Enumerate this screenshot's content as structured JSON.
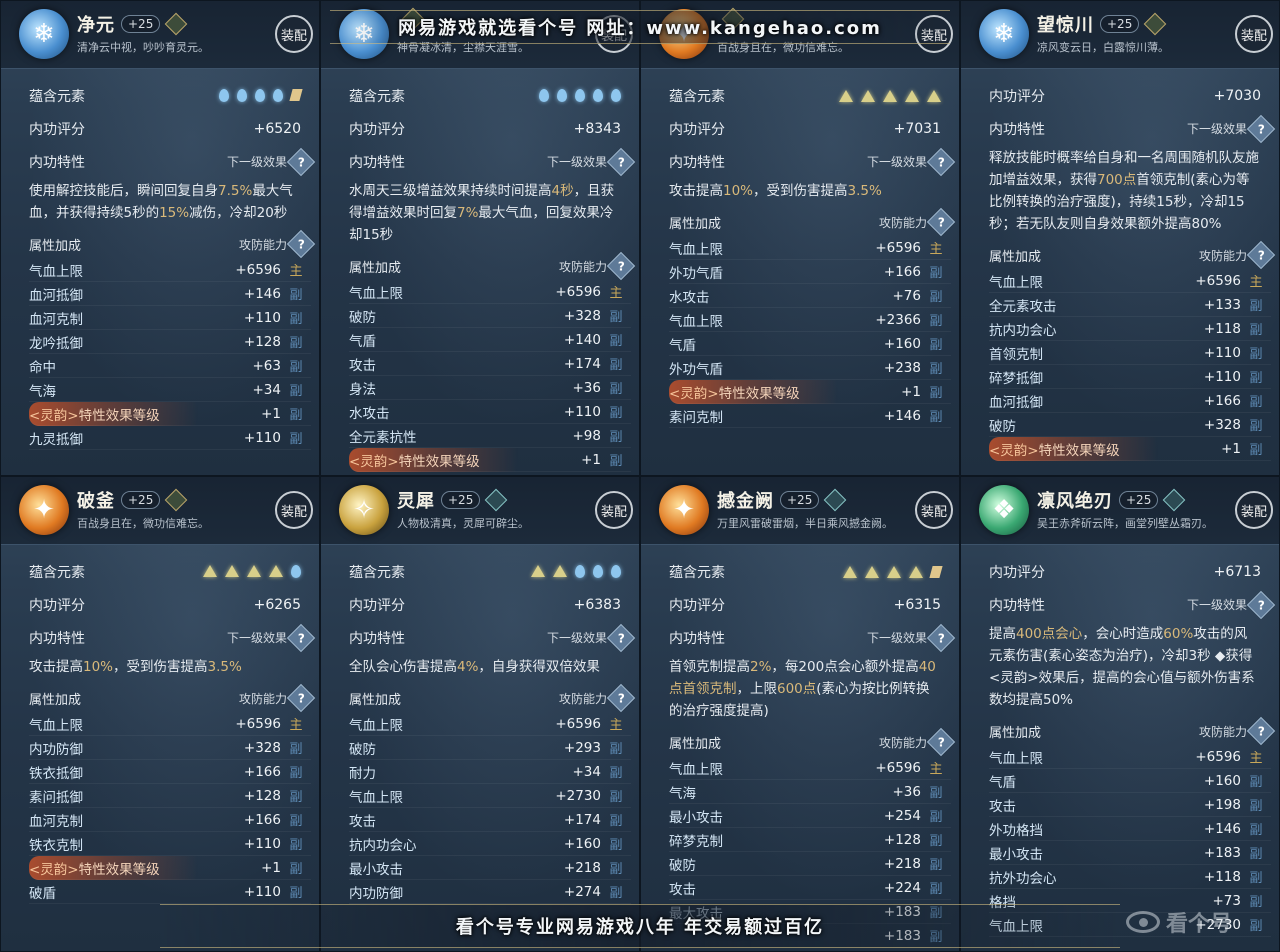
{
  "watermark_top": "网易游戏就选看个号   网址：www.kangehao.com",
  "watermark_bottom": "看个号专业网易游戏八年  年交易额过百亿",
  "corner_logo_text": "看个号",
  "common": {
    "equip": "装配",
    "elements_label": "蕴含元素",
    "score_label": "内功评分",
    "trait_label": "内功特性",
    "next_level": "下一级效果",
    "attr_label": "属性加成",
    "attr_sub": "攻防能力",
    "help": "?"
  },
  "cards": [
    {
      "name": "净元",
      "level": "+25",
      "emblem": "blue",
      "grade": "gold",
      "desc": "清净云中视，吵吵育灵元。",
      "elements": [
        "drop",
        "drop",
        "drop",
        "drop",
        "flag"
      ],
      "score": "+6520",
      "effect": [
        {
          "t": "使用解控技能后，瞬间回复自身"
        },
        {
          "t": "7.5%",
          "h": true
        },
        {
          "t": "最大气血，并获得持续5秒的"
        },
        {
          "t": "15%",
          "h": true
        },
        {
          "t": "减伤，冷却20秒"
        }
      ],
      "stats": [
        {
          "n": "气血上限",
          "v": "+6596",
          "t": "主"
        },
        {
          "n": "血河抵御",
          "v": "+146",
          "t": "副"
        },
        {
          "n": "血河克制",
          "v": "+110",
          "t": "副"
        },
        {
          "n": "龙吟抵御",
          "v": "+128",
          "t": "副"
        },
        {
          "n": "命中",
          "v": "+63",
          "t": "副"
        },
        {
          "n": "气海",
          "v": "+34",
          "t": "副"
        },
        {
          "n": "特性效果等级",
          "tag": "<灵韵>",
          "v": "+1",
          "t": "副",
          "special": true
        },
        {
          "n": "九灵抵御",
          "v": "+110",
          "t": "副"
        }
      ]
    },
    {
      "name": "",
      "level": "",
      "emblem": "blue",
      "grade": "gold",
      "desc": "神骨凝冰清，尘襟天涯雪。",
      "elements": [
        "drop",
        "drop",
        "drop",
        "drop",
        "drop"
      ],
      "score": "+8343",
      "effect": [
        {
          "t": "水周天三级增益效果持续时间提高"
        },
        {
          "t": "4秒",
          "h": true
        },
        {
          "t": "，且获得增益效果时回复"
        },
        {
          "t": "7%",
          "h": true
        },
        {
          "t": "最大气血，回复效果冷却15秒"
        }
      ],
      "stats": [
        {
          "n": "气血上限",
          "v": "+6596",
          "t": "主"
        },
        {
          "n": "破防",
          "v": "+328",
          "t": "副"
        },
        {
          "n": "气盾",
          "v": "+140",
          "t": "副"
        },
        {
          "n": "攻击",
          "v": "+174",
          "t": "副"
        },
        {
          "n": "身法",
          "v": "+36",
          "t": "副"
        },
        {
          "n": "水攻击",
          "v": "+110",
          "t": "副"
        },
        {
          "n": "全元素抗性",
          "v": "+98",
          "t": "副"
        },
        {
          "n": "特性效果等级",
          "tag": "<灵韵>",
          "v": "+1",
          "t": "副",
          "special": true
        }
      ]
    },
    {
      "name": "",
      "level": "",
      "emblem": "fire",
      "grade": "gold",
      "desc": "百战身且在，微功信难忘。",
      "elements": [
        "tri",
        "tri",
        "tri",
        "tri",
        "tri"
      ],
      "score": "+7031",
      "effect": [
        {
          "t": "攻击提高"
        },
        {
          "t": "10%",
          "h": true
        },
        {
          "t": "，受到伤害提高"
        },
        {
          "t": "3.5%",
          "h": true
        }
      ],
      "stats": [
        {
          "n": "气血上限",
          "v": "+6596",
          "t": "主"
        },
        {
          "n": "外功气盾",
          "v": "+166",
          "t": "副"
        },
        {
          "n": "水攻击",
          "v": "+76",
          "t": "副"
        },
        {
          "n": "气血上限",
          "v": "+2366",
          "t": "副"
        },
        {
          "n": "气盾",
          "v": "+160",
          "t": "副"
        },
        {
          "n": "外功气盾",
          "v": "+238",
          "t": "副"
        },
        {
          "n": "特性效果等级",
          "tag": "<灵韵>",
          "v": "+1",
          "t": "副",
          "special": true
        },
        {
          "n": "素问克制",
          "v": "+146",
          "t": "副"
        }
      ]
    },
    {
      "name": "望惊川",
      "level": "+25",
      "emblem": "blue",
      "grade": "gold",
      "desc": "凉风变云日，白露惊川薄。",
      "elements": [],
      "score": "+7030",
      "effect": [
        {
          "t": "释放技能时概率给自身和一名周围随机队友施加增益效果，获得"
        },
        {
          "t": "700点",
          "h": true
        },
        {
          "t": "首领克制(素心为等比例转换的治疗强度)，持续15秒，冷却15秒；若无队友则自身效果额外提高80%"
        }
      ],
      "stats": [
        {
          "n": "气血上限",
          "v": "+6596",
          "t": "主"
        },
        {
          "n": "全元素攻击",
          "v": "+133",
          "t": "副"
        },
        {
          "n": "抗内功会心",
          "v": "+118",
          "t": "副"
        },
        {
          "n": "首领克制",
          "v": "+110",
          "t": "副"
        },
        {
          "n": "碎梦抵御",
          "v": "+110",
          "t": "副"
        },
        {
          "n": "血河抵御",
          "v": "+166",
          "t": "副"
        },
        {
          "n": "破防",
          "v": "+328",
          "t": "副"
        },
        {
          "n": "特性效果等级",
          "tag": "<灵韵>",
          "v": "+1",
          "t": "副",
          "special": true
        }
      ]
    },
    {
      "name": "破釜",
      "level": "+25",
      "emblem": "fire",
      "grade": "gold",
      "desc": "百战身且在，微功信难忘。",
      "elements": [
        "tri",
        "tri",
        "tri",
        "tri",
        "drop"
      ],
      "score": "+6265",
      "effect": [
        {
          "t": "攻击提高"
        },
        {
          "t": "10%",
          "h": true
        },
        {
          "t": "，受到伤害提高"
        },
        {
          "t": "3.5%",
          "h": true
        }
      ],
      "stats": [
        {
          "n": "气血上限",
          "v": "+6596",
          "t": "主"
        },
        {
          "n": "内功防御",
          "v": "+328",
          "t": "副"
        },
        {
          "n": "铁衣抵御",
          "v": "+166",
          "t": "副"
        },
        {
          "n": "素问抵御",
          "v": "+128",
          "t": "副"
        },
        {
          "n": "血河克制",
          "v": "+166",
          "t": "副"
        },
        {
          "n": "铁衣克制",
          "v": "+110",
          "t": "副"
        },
        {
          "n": "特性效果等级",
          "tag": "<灵韵>",
          "v": "+1",
          "t": "副",
          "special": true
        },
        {
          "n": "破盾",
          "v": "+110",
          "t": "副"
        }
      ]
    },
    {
      "name": "灵犀",
      "level": "+25",
      "emblem": "gold",
      "grade": "teal",
      "desc": "人物极清真，灵犀可辟尘。",
      "elements": [
        "tri",
        "tri",
        "drop",
        "drop",
        "drop"
      ],
      "score": "+6383",
      "effect": [
        {
          "t": "全队会心伤害提高"
        },
        {
          "t": "4%",
          "h": true
        },
        {
          "t": "，自身获得双倍效果"
        }
      ],
      "stats": [
        {
          "n": "气血上限",
          "v": "+6596",
          "t": "主"
        },
        {
          "n": "破防",
          "v": "+293",
          "t": "副"
        },
        {
          "n": "耐力",
          "v": "+34",
          "t": "副"
        },
        {
          "n": "气血上限",
          "v": "+2730",
          "t": "副"
        },
        {
          "n": "攻击",
          "v": "+174",
          "t": "副"
        },
        {
          "n": "抗内功会心",
          "v": "+160",
          "t": "副"
        },
        {
          "n": "最小攻击",
          "v": "+218",
          "t": "副"
        },
        {
          "n": "内功防御",
          "v": "+274",
          "t": "副"
        }
      ]
    },
    {
      "name": "撼金阙",
      "level": "+25",
      "emblem": "fire",
      "grade": "teal",
      "desc": "万里风雷破雷烟，半日乘风撼金阙。",
      "elements": [
        "tri",
        "tri",
        "tri",
        "tri",
        "flag"
      ],
      "score": "+6315",
      "effect": [
        {
          "t": "首领克制提高"
        },
        {
          "t": "2%",
          "h": true
        },
        {
          "t": "，每200点会心额外提高"
        },
        {
          "t": "40点首领克制",
          "h": true
        },
        {
          "t": "，上限"
        },
        {
          "t": "600点",
          "h": true
        },
        {
          "t": "(素心为按比例转换的治疗强度提高)"
        }
      ],
      "stats": [
        {
          "n": "气血上限",
          "v": "+6596",
          "t": "主"
        },
        {
          "n": "气海",
          "v": "+36",
          "t": "副"
        },
        {
          "n": "最小攻击",
          "v": "+254",
          "t": "副"
        },
        {
          "n": "碎梦克制",
          "v": "+128",
          "t": "副"
        },
        {
          "n": "破防",
          "v": "+218",
          "t": "副"
        },
        {
          "n": "攻击",
          "v": "+224",
          "t": "副"
        },
        {
          "n": "最大攻击",
          "v": "+183",
          "t": "副"
        },
        {
          "n": "",
          "v": "+183",
          "t": "副"
        }
      ]
    },
    {
      "name": "凛风绝刃",
      "level": "+25",
      "emblem": "green",
      "grade": "teal",
      "desc": "吴王赤斧斫云阵，画堂列壁丛霜刃。",
      "elements": [],
      "score": "+6713",
      "effect": [
        {
          "t": "提高"
        },
        {
          "t": "400点会心",
          "h": true
        },
        {
          "t": "，会心时造成"
        },
        {
          "t": "60%",
          "h": true
        },
        {
          "t": "攻击的风元素伤害(素心姿态为治疗)，冷却3秒 ◆获得<灵韵>效果后，提高的会心值与额外伤害系数均提高50%"
        }
      ],
      "stats": [
        {
          "n": "气血上限",
          "v": "+6596",
          "t": "主"
        },
        {
          "n": "气盾",
          "v": "+160",
          "t": "副"
        },
        {
          "n": "攻击",
          "v": "+198",
          "t": "副"
        },
        {
          "n": "外功格挡",
          "v": "+146",
          "t": "副"
        },
        {
          "n": "最小攻击",
          "v": "+183",
          "t": "副"
        },
        {
          "n": "抗外功会心",
          "v": "+118",
          "t": "副"
        },
        {
          "n": "格挡",
          "v": "+73",
          "t": "副"
        },
        {
          "n": "气血上限",
          "v": "+2730",
          "t": "副"
        }
      ]
    }
  ]
}
